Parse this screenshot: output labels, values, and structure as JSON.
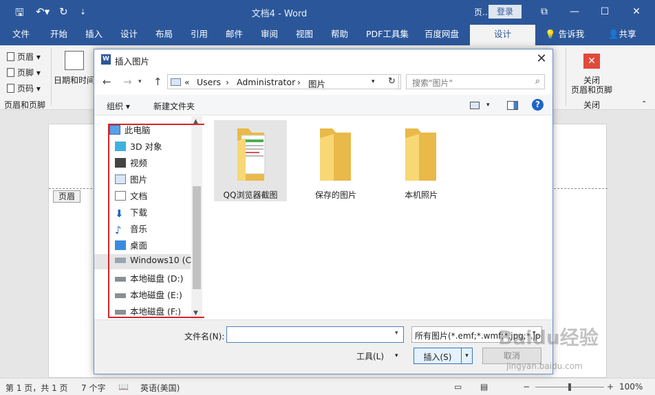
{
  "titlebar": {
    "title": "文档4 - Word",
    "page_trunc": "页…",
    "login": "登录",
    "ctl_restore": "⧉",
    "ctl_min": "—",
    "ctl_max": "☐",
    "ctl_close": "✕"
  },
  "tabs": [
    "文件",
    "开始",
    "插入",
    "设计",
    "布局",
    "引用",
    "邮件",
    "审阅",
    "视图",
    "帮助",
    "PDF工具集",
    "百度网盘"
  ],
  "active_tab": "设计",
  "tell_me": "告诉我",
  "share": "共享",
  "ribbon": {
    "header": "页眉",
    "footer": "页脚",
    "page_number": "页码",
    "group1": "页眉和页脚",
    "datetime": "日期和时间",
    "close_line1": "关闭",
    "close_line2": "页眉和页脚",
    "close_group": "关闭"
  },
  "document": {
    "header_tag": "页眉"
  },
  "statusbar": {
    "pages": "第 1 页，共 1 页",
    "words": "7 个字",
    "language": "英语(美国)",
    "zoom": "100%"
  },
  "dialog": {
    "title": "插入图片",
    "address": {
      "prefix": "«",
      "crumbs": [
        "Users",
        "Administrator",
        "图片"
      ]
    },
    "search_placeholder": "搜索\"图片\"",
    "organize": "组织 ▾",
    "new_folder": "新建文件夹",
    "nav_items": [
      {
        "label": "此电脑",
        "icon": "computer-icon"
      },
      {
        "label": "3D 对象",
        "icon": "3d-objects-icon"
      },
      {
        "label": "视频",
        "icon": "video-icon"
      },
      {
        "label": "图片",
        "icon": "pictures-icon"
      },
      {
        "label": "文档",
        "icon": "documents-icon"
      },
      {
        "label": "下载",
        "icon": "download-icon"
      },
      {
        "label": "音乐",
        "icon": "music-icon"
      },
      {
        "label": "桌面",
        "icon": "desktop-icon"
      },
      {
        "label": "Windows10 (C:",
        "icon": "drive-c-icon"
      },
      {
        "label": "本地磁盘 (D:)",
        "icon": "drive-icon"
      },
      {
        "label": "本地磁盘 (E:)",
        "icon": "drive-icon"
      },
      {
        "label": "本地磁盘 (F:)",
        "icon": "drive-icon"
      }
    ],
    "folders": [
      "QQ浏览器截图",
      "保存的图片",
      "本机照片"
    ],
    "filename_label": "文件名(N):",
    "filename_value": "",
    "filter": "所有图片(*.emf;*.wmf;*.jpg;*.jp",
    "tools": "工具(L)",
    "insert": "插入(S)",
    "cancel": "取消"
  },
  "watermark": {
    "text": "Baidu经验",
    "url": "jingyan.baidu.com"
  },
  "colors": {
    "word_blue": "#2b579a",
    "highlight_red": "#d8232a",
    "folder_yellow": "#f8d775"
  }
}
